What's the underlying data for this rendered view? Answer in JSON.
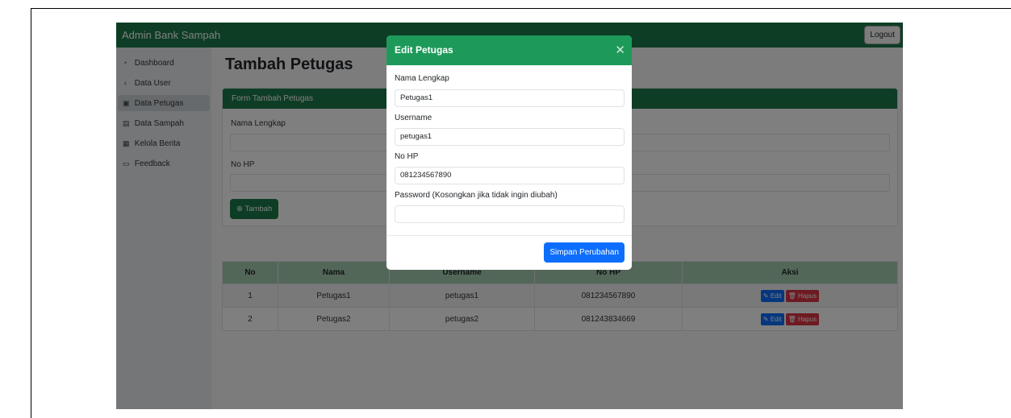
{
  "navbar": {
    "brand": "Admin Bank Sampah",
    "logout_label": "Logout"
  },
  "sidebar": {
    "items": [
      {
        "label": "Dashboard",
        "icon": "dashboard-icon"
      },
      {
        "label": "Data User",
        "icon": "users-icon"
      },
      {
        "label": "Data Petugas",
        "icon": "id-card-icon"
      },
      {
        "label": "Data Sampah",
        "icon": "trash-icon"
      },
      {
        "label": "Kelola Berita",
        "icon": "newspaper-icon"
      },
      {
        "label": "Feedback",
        "icon": "chat-icon"
      }
    ],
    "active_index": 2
  },
  "page": {
    "title": "Tambah Petugas"
  },
  "form": {
    "header": "Form Tambah Petugas",
    "nama_label": "Nama Lengkap",
    "nohp_label": "No HP",
    "tambah_label": "Tambah"
  },
  "table": {
    "columns": [
      "No",
      "Nama",
      "Username",
      "No HP",
      "Aksi"
    ],
    "rows": [
      {
        "no": "1",
        "nama": "Petugas1",
        "username": "petugas1",
        "nohp": "081234567890"
      },
      {
        "no": "2",
        "nama": "Petugas2",
        "username": "petugas2",
        "nohp": "081243834669"
      }
    ],
    "edit_label": "Edit",
    "hapus_label": "Hapus"
  },
  "modal": {
    "title": "Edit Petugas",
    "nama_label": "Nama Lengkap",
    "nama_value": "Petugas1",
    "username_label": "Username",
    "username_value": "petugas1",
    "nohp_label": "No HP",
    "nohp_value": "081234567890",
    "password_label": "Password (Kosongkan jika tidak ingin diubah)",
    "password_value": "",
    "save_label": "Simpan Perubahan"
  },
  "colors": {
    "primary_green": "#1d7a4a",
    "modal_green": "#1d9a5a",
    "blue": "#0d6efd",
    "red": "#dc3545"
  }
}
